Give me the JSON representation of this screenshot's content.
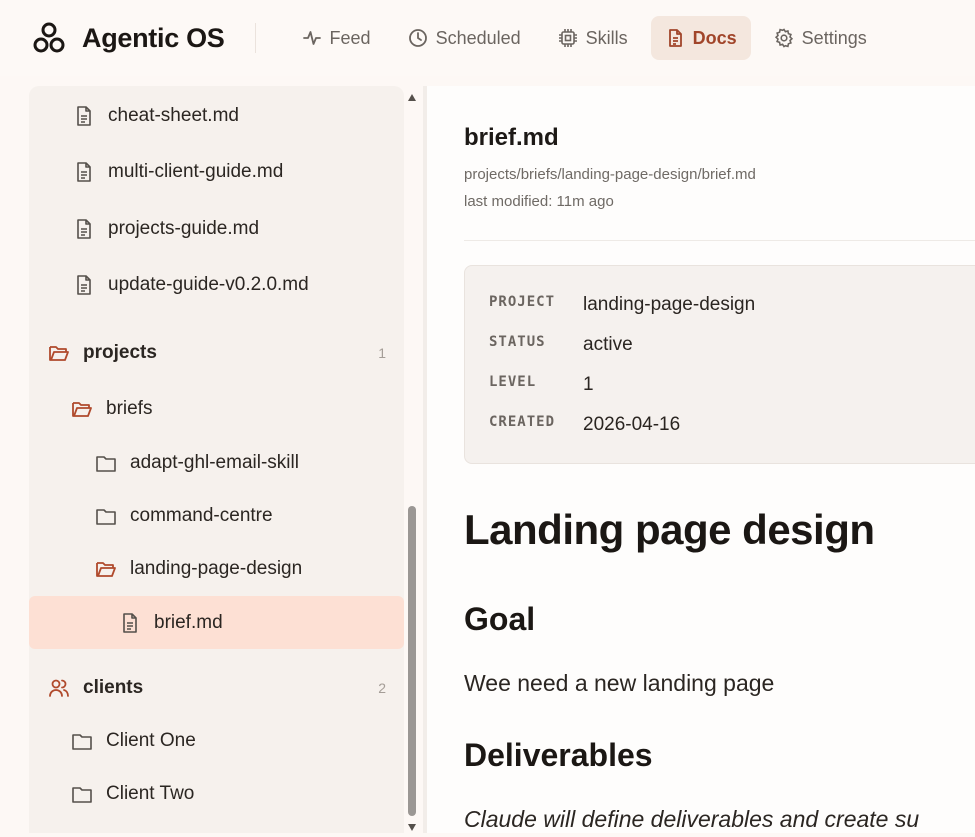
{
  "app": {
    "title": "Agentic OS"
  },
  "nav": {
    "items": [
      {
        "label": "Feed",
        "icon": "activity-icon",
        "active": false
      },
      {
        "label": "Scheduled",
        "icon": "clock-icon",
        "active": false
      },
      {
        "label": "Skills",
        "icon": "cpu-icon",
        "active": false
      },
      {
        "label": "Docs",
        "icon": "document-icon",
        "active": true
      },
      {
        "label": "Settings",
        "icon": "gear-icon",
        "active": false
      }
    ]
  },
  "sidebar": {
    "files_top": [
      "cheat-sheet.md",
      "multi-client-guide.md",
      "projects-guide.md",
      "update-guide-v0.2.0.md"
    ],
    "projects": {
      "label": "projects",
      "count": "1"
    },
    "briefs": {
      "label": "briefs"
    },
    "brief_folders": [
      "adapt-ghl-email-skill",
      "command-centre",
      "landing-page-design"
    ],
    "selected_file": "brief.md",
    "clients": {
      "label": "clients",
      "count": "2"
    },
    "client_folders": [
      "Client One",
      "Client Two"
    ]
  },
  "doc": {
    "title": "brief.md",
    "path": "projects/briefs/landing-page-design/brief.md",
    "modified": "last modified: 11m ago",
    "meta": [
      {
        "key": "PROJECT",
        "value": "landing-page-design"
      },
      {
        "key": "STATUS",
        "value": "active"
      },
      {
        "key": "LEVEL",
        "value": "1"
      },
      {
        "key": "CREATED",
        "value": "2026-04-16"
      }
    ],
    "h1": "Landing page design",
    "goal_heading": "Goal",
    "goal_text": "Wee need a new landing page",
    "deliverables_heading": "Deliverables",
    "deliverables_text": "Claude will define deliverables and create su"
  },
  "colors": {
    "accent": "#a1452a",
    "selected_bg": "#fde0d4",
    "sidebar_bg": "#f6f1ed"
  }
}
